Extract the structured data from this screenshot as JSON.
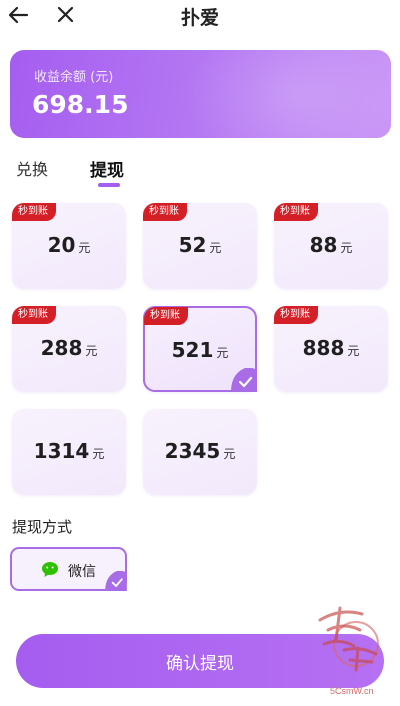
{
  "header": {
    "title": "扑爱",
    "back_icon": "arrow-left-icon",
    "close_icon": "close-icon"
  },
  "balance": {
    "label": "收益余额 (元)",
    "value": "698.15"
  },
  "tabs": [
    {
      "label": "兑换",
      "active": false
    },
    {
      "label": "提现",
      "active": true
    }
  ],
  "withdraw_options": [
    {
      "badge": "秒到账",
      "amount": "20",
      "unit": "元",
      "selected": false
    },
    {
      "badge": "秒到账",
      "amount": "52",
      "unit": "元",
      "selected": false
    },
    {
      "badge": "秒到账",
      "amount": "88",
      "unit": "元",
      "selected": false
    },
    {
      "badge": "秒到账",
      "amount": "288",
      "unit": "元",
      "selected": false
    },
    {
      "badge": "秒到账",
      "amount": "521",
      "unit": "元",
      "selected": true
    },
    {
      "badge": "秒到账",
      "amount": "888",
      "unit": "元",
      "selected": false
    },
    {
      "badge": "",
      "amount": "1314",
      "unit": "元",
      "selected": false
    },
    {
      "badge": "",
      "amount": "2345",
      "unit": "元",
      "selected": false
    }
  ],
  "method": {
    "title": "提现方式",
    "option_label": "微信",
    "icon": "wechat-icon",
    "selected": true
  },
  "confirm_button": "确认提现",
  "watermark": {
    "text": "5CsmW.cn",
    "logo": "logo-stamp"
  },
  "colors": {
    "accent": "#a55df0",
    "badge": "#d41f27",
    "wechat": "#2dc100"
  }
}
